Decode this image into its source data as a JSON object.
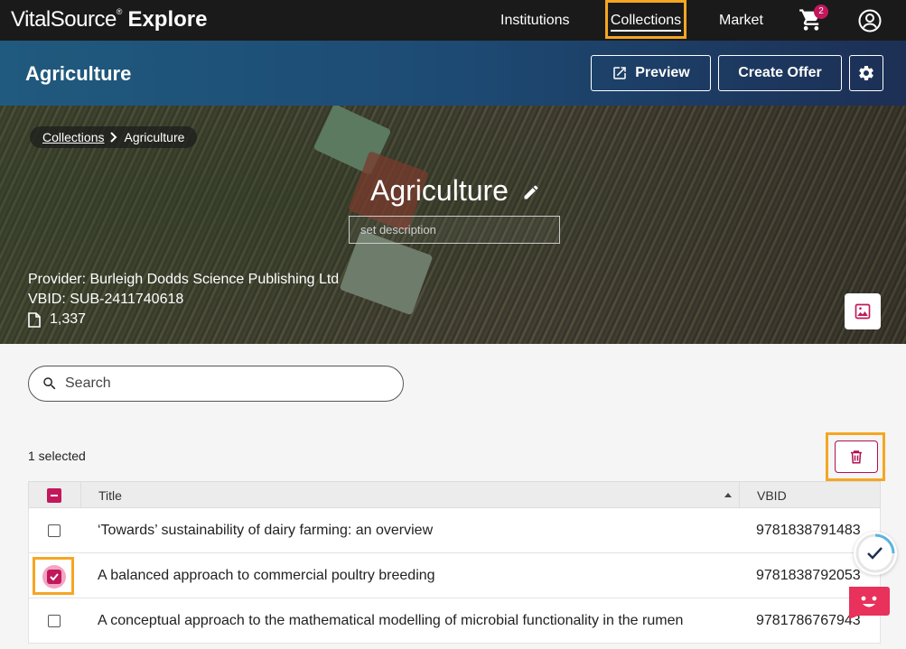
{
  "nav": {
    "brand_light": "VitalSource",
    "brand_reg": "®",
    "brand_bold": "Explore",
    "links": [
      "Institutions",
      "Collections",
      "Market"
    ],
    "cart_count": "2"
  },
  "header": {
    "title": "Agriculture",
    "preview_label": "Preview",
    "create_offer_label": "Create Offer"
  },
  "hero": {
    "breadcrumb": {
      "parent": "Collections",
      "current": "Agriculture"
    },
    "title": "Agriculture",
    "description_placeholder": "set description",
    "provider": "Provider: Burleigh Dodds Science Publishing Ltd",
    "vbid": "VBID: SUB-2411740618",
    "count": "1,337"
  },
  "search": {
    "placeholder": "Search"
  },
  "selection": {
    "label": "1 selected"
  },
  "table": {
    "columns": [
      "Title",
      "VBID"
    ],
    "rows": [
      {
        "title": "‘Towards’ sustainability of dairy farming: an overview",
        "vbid": "9781838791483",
        "checked": false
      },
      {
        "title": "A balanced approach to commercial poultry breeding",
        "vbid": "9781838792053",
        "checked": true
      },
      {
        "title": "A conceptual approach to the mathematical modelling of microbial functionality in the rumen",
        "vbid": "9781786767943",
        "checked": false
      }
    ]
  },
  "colors": {
    "nav_bg": "#1a1a1a",
    "accent": "#c2185b",
    "highlight": "#f5a623",
    "header_start": "#205a7e",
    "header_end": "#1d2f55"
  }
}
